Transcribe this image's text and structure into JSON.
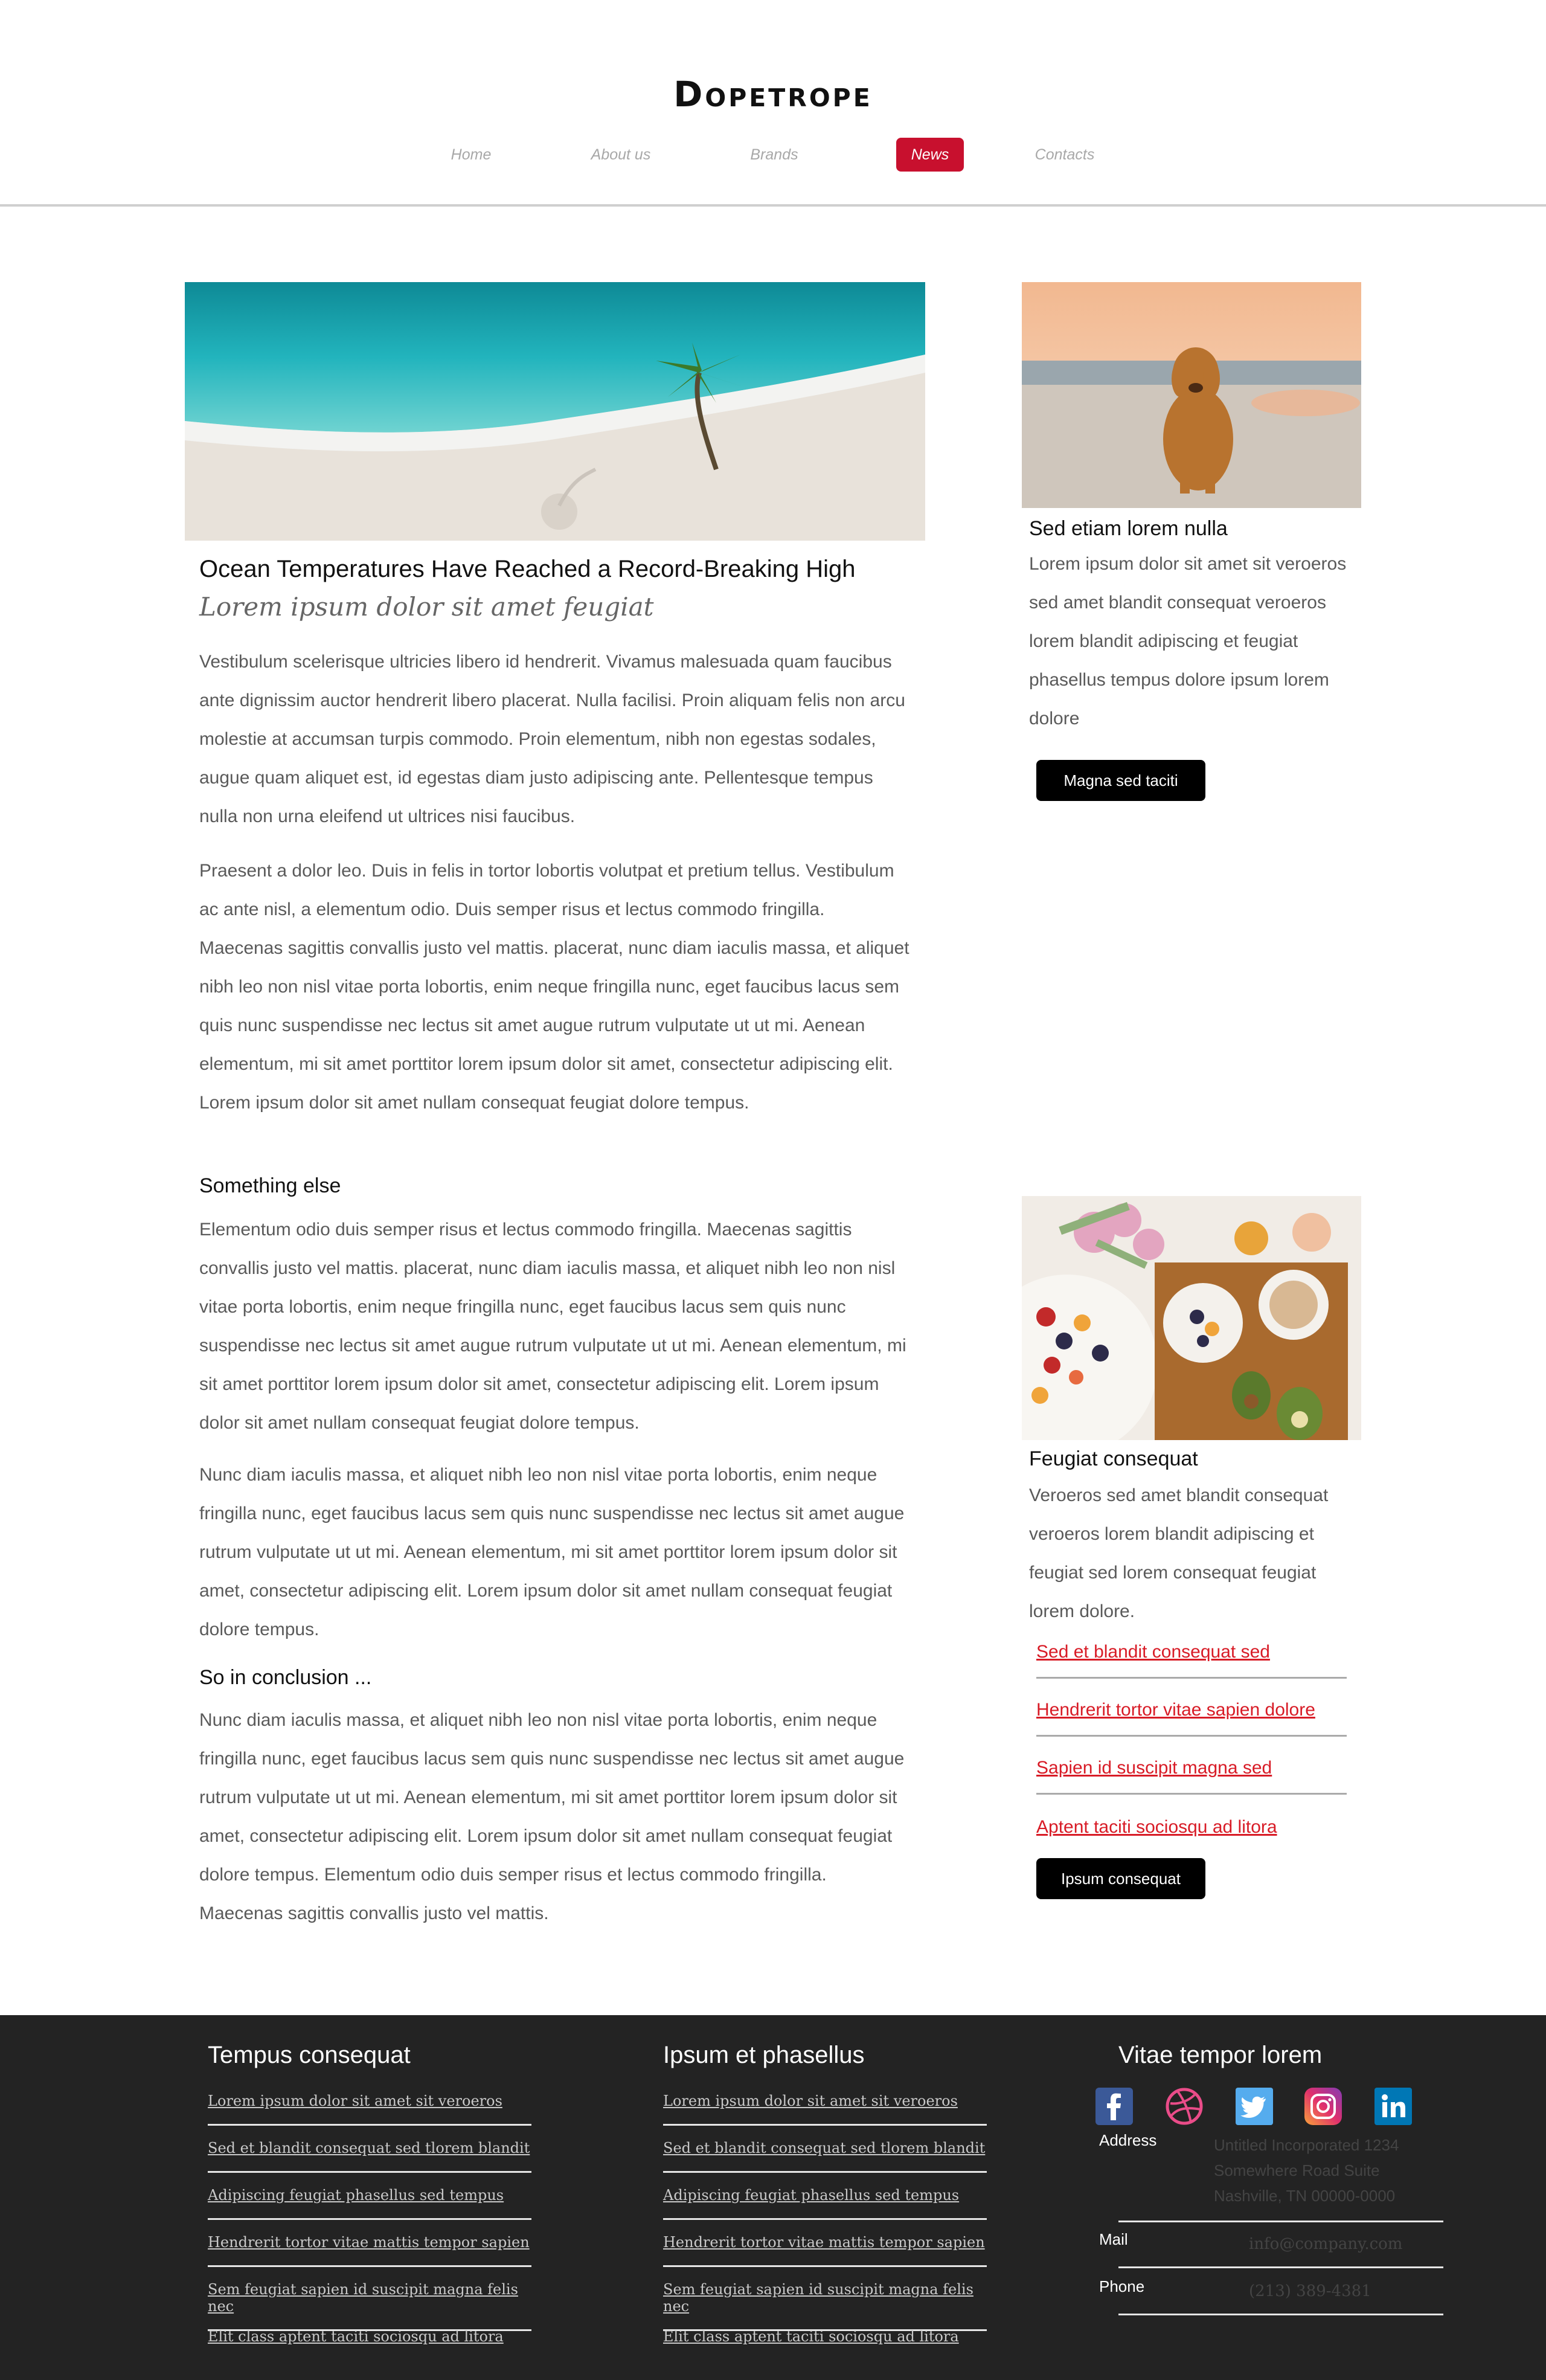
{
  "site": {
    "logo": "Dopetrope"
  },
  "nav": [
    {
      "label": "Home",
      "active": false
    },
    {
      "label": "About us",
      "active": false
    },
    {
      "label": "Brands",
      "active": false
    },
    {
      "label": "News",
      "active": true
    },
    {
      "label": "Contacts",
      "active": false
    }
  ],
  "colors": {
    "accent": "#c8102e",
    "link_red": "#d81b26",
    "footer_bg": "#232323"
  },
  "article": {
    "title": "Ocean Temperatures Have Reached a Record-Breaking High",
    "subtitle": "Lorem ipsum dolor sit amet feugiat",
    "p1": "Vestibulum scelerisque ultricies libero id hendrerit. Vivamus malesuada quam faucibus ante dignissim auctor hendrerit libero placerat. Nulla facilisi. Proin aliquam felis non arcu molestie at accumsan turpis commodo. Proin elementum, nibh non egestas sodales, augue quam aliquet est, id egestas diam justo adipiscing ante. Pellentesque tempus nulla non urna eleifend ut ultrices nisi faucibus.",
    "p2": "Praesent a dolor leo. Duis in felis in tortor lobortis volutpat et pretium tellus. Vestibulum ac ante nisl, a elementum odio. Duis semper risus et lectus commodo fringilla. Maecenas sagittis convallis justo vel mattis. placerat, nunc diam iaculis massa, et aliquet nibh leo non nisl vitae porta lobortis, enim neque fringilla nunc, eget faucibus lacus sem quis nunc suspendisse nec lectus sit amet augue rutrum vulputate ut ut mi. Aenean elementum, mi sit amet porttitor lorem ipsum dolor sit amet, consectetur adipiscing elit. Lorem ipsum dolor sit amet nullam consequat feugiat dolore tempus.",
    "h2": "Something else",
    "p3": "Elementum odio duis semper risus et lectus commodo fringilla. Maecenas sagittis convallis justo vel mattis. placerat, nunc diam iaculis massa, et aliquet nibh leo non nisl vitae porta lobortis, enim neque fringilla nunc, eget faucibus lacus sem quis nunc suspendisse nec lectus sit amet augue rutrum vulputate ut ut mi. Aenean elementum, mi sit amet porttitor lorem ipsum dolor sit amet, consectetur adipiscing elit. Lorem ipsum dolor sit amet nullam consequat feugiat dolore tempus.",
    "p4": "Nunc diam iaculis massa, et aliquet nibh leo non nisl vitae porta lobortis, enim neque fringilla nunc, eget faucibus lacus sem quis nunc suspendisse nec lectus sit amet augue rutrum vulputate ut ut mi. Aenean elementum, mi sit amet porttitor lorem ipsum dolor sit amet, consectetur adipiscing elit. Lorem ipsum dolor sit amet nullam consequat feugiat dolore tempus.",
    "h3": "So in conclusion ...",
    "p5": "Nunc diam iaculis massa, et aliquet nibh leo non nisl vitae porta lobortis, enim neque fringilla nunc, eget faucibus lacus sem quis nunc suspendisse nec lectus sit amet augue rutrum vulputate ut ut mi. Aenean elementum, mi sit amet porttitor lorem ipsum dolor sit amet, consectetur adipiscing elit. Lorem ipsum dolor sit amet nullam consequat feugiat dolore tempus. Elementum odio duis semper risus et lectus commodo fringilla. Maecenas sagittis convallis justo vel mattis."
  },
  "sidebar": {
    "card1": {
      "title": "Sed etiam lorem nulla",
      "text": "Lorem ipsum dolor sit amet sit veroeros sed amet blandit consequat veroeros lorem blandit adipiscing et feugiat phasellus tempus dolore ipsum lorem dolore",
      "button": "Magna sed taciti"
    },
    "card2": {
      "title": "Feugiat consequat",
      "text": "Veroeros sed amet blandit consequat veroeros lorem blandit adipiscing et feugiat sed lorem consequat feugiat lorem dolore.",
      "links": [
        "Sed et blandit consequat sed",
        "Hendrerit tortor vitae sapien dolore",
        "Sapien id suscipit magna sed",
        "Aptent taciti sociosqu ad litora"
      ],
      "button": "Ipsum consequat"
    }
  },
  "footer": {
    "col1": {
      "title": "Tempus consequat",
      "links": [
        "Lorem ipsum dolor sit amet sit veroeros",
        "Sed et blandit consequat sed tlorem blandit",
        "Adipiscing feugiat phasellus sed tempus",
        "Hendrerit tortor vitae mattis tempor sapien",
        "Sem feugiat sapien id suscipit magna felis nec",
        "Elit class aptent taciti sociosqu ad litora"
      ]
    },
    "col2": {
      "title": "Ipsum et phasellus",
      "links": [
        "Lorem ipsum dolor sit amet sit veroeros",
        "Sed et blandit consequat sed tlorem blandit",
        "Adipiscing feugiat phasellus sed tempus",
        "Hendrerit tortor vitae mattis tempor sapien",
        "Sem feugiat sapien id suscipit magna felis nec",
        "Elit class aptent taciti sociosqu ad litora"
      ]
    },
    "col3": {
      "title": "Vitae tempor lorem",
      "social": [
        "facebook-icon",
        "dribbble-icon",
        "twitter-icon",
        "instagram-icon",
        "linkedin-icon"
      ],
      "address_label": "Address",
      "address_lines": [
        "Untitled Incorporated 1234",
        "Somewhere Road Suite",
        "Nashville, TN 00000-0000"
      ],
      "mail_label": "Mail",
      "mail_value": "info@company.com",
      "phone_label": "Phone",
      "phone_value": "(213) 389-4381"
    }
  }
}
